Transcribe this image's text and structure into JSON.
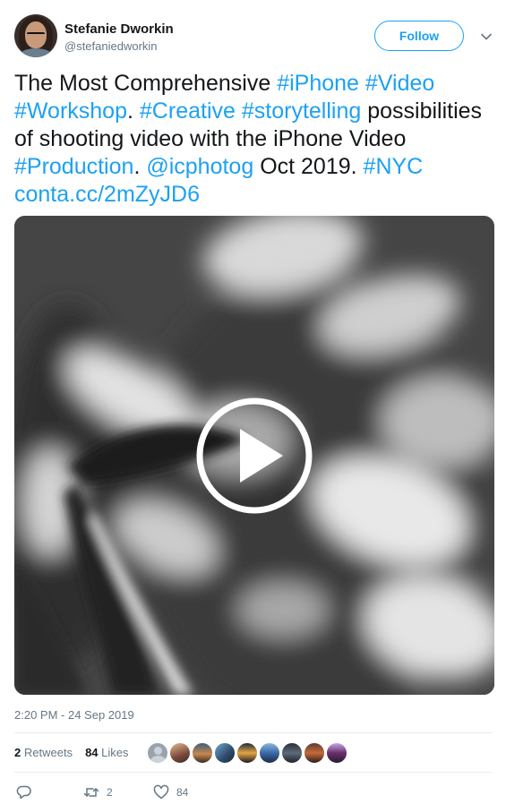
{
  "author": {
    "name": "Stefanie Dworkin",
    "handle": "@stefaniedworkin",
    "follow_label": "Follow"
  },
  "tweet": {
    "segments": [
      {
        "text": "The Most Comprehensive ",
        "link": false
      },
      {
        "text": "#iPhone",
        "link": true
      },
      {
        "text": " ",
        "link": false
      },
      {
        "text": "#Video",
        "link": true
      },
      {
        "text": " ",
        "link": false
      },
      {
        "text": "#Workshop",
        "link": true
      },
      {
        "text": ". ",
        "link": false
      },
      {
        "text": "#Creative",
        "link": true
      },
      {
        "text": " ",
        "link": false
      },
      {
        "text": "#storytelling",
        "link": true
      },
      {
        "text": " possibilities of shooting video with the iPhone Video ",
        "link": false
      },
      {
        "text": "#Production",
        "link": true
      },
      {
        "text": ". ",
        "link": false
      },
      {
        "text": "@icphotog",
        "link": true
      },
      {
        "text": " Oct 2019. ",
        "link": false
      },
      {
        "text": "#NYC",
        "link": true
      },
      {
        "text": " ",
        "link": false
      },
      {
        "text": "conta.cc/2mZyJD6",
        "link": true
      }
    ],
    "timestamp": "2:20 PM - 24 Sep 2019"
  },
  "stats": {
    "retweets_count": "2",
    "retweets_label": "Retweets",
    "likes_count": "84",
    "likes_label": "Likes"
  },
  "actions": {
    "retweet_count": "2",
    "like_count": "84"
  },
  "colors": {
    "accent": "#1da1f2",
    "muted": "#657786",
    "text": "#14171a"
  },
  "icons": [
    "chevron-down-icon",
    "play-icon",
    "reply-icon",
    "retweet-icon",
    "heart-icon"
  ]
}
